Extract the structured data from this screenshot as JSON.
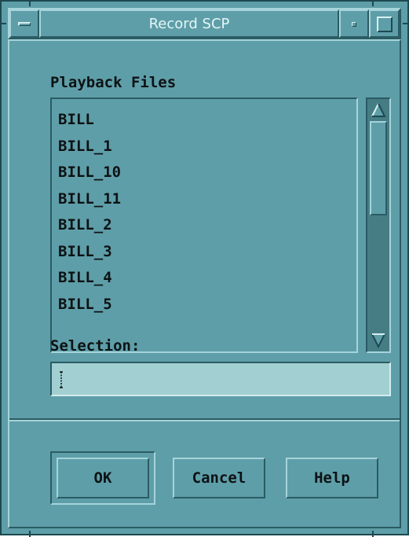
{
  "window": {
    "title": "Record SCP",
    "menu_icon": "window-menu-icon",
    "minimize_icon": "minimize-icon",
    "maximize_icon": "maximize-icon"
  },
  "dialog": {
    "list_label": "Playback Files",
    "files": [
      "BILL",
      "BILL_1",
      "BILL_10",
      "BILL_11",
      "BILL_2",
      "BILL_3",
      "BILL_4",
      "BILL_5"
    ],
    "selection_label": "Selection:",
    "selection_value": ""
  },
  "scrollbar": {
    "up_icon": "scroll-up-arrow-icon",
    "down_icon": "scroll-down-arrow-icon"
  },
  "buttons": {
    "ok": "OK",
    "cancel": "Cancel",
    "help": "Help"
  },
  "colors": {
    "background": "#5e9ea8",
    "input_background": "#a2d0d2",
    "text": "#0d1214"
  }
}
